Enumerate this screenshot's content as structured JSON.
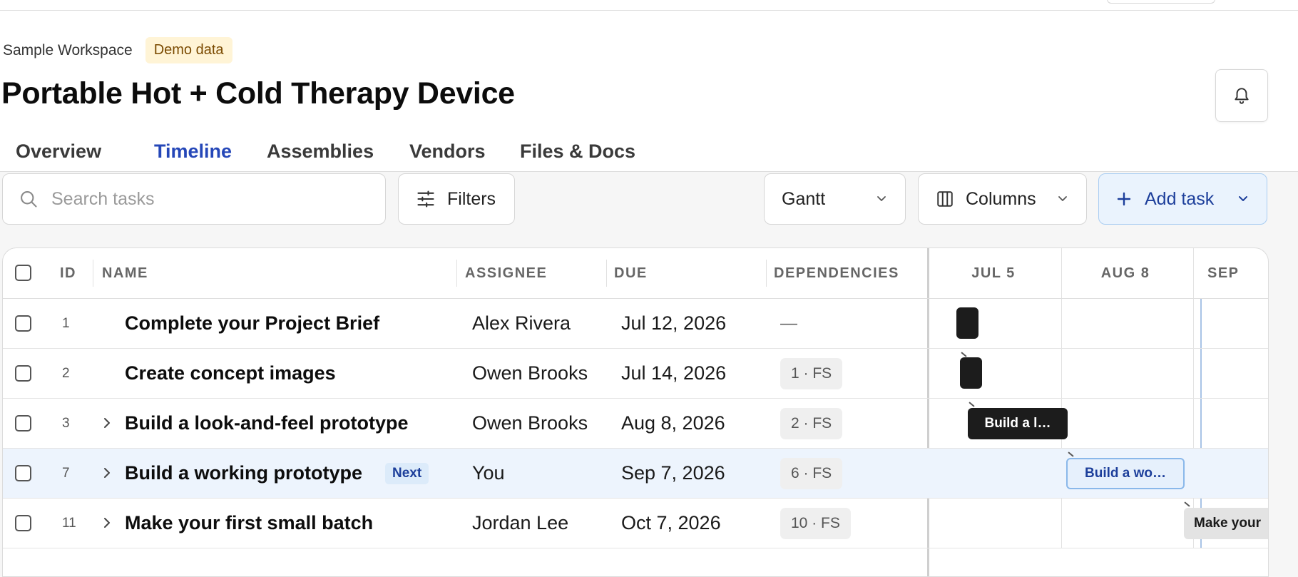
{
  "header": {
    "workspace": "Sample Workspace",
    "badge": "Demo data",
    "title": "Portable Hot + Cold Therapy Device"
  },
  "tabs": [
    {
      "label": "Overview"
    },
    {
      "label": "Timeline",
      "active": true
    },
    {
      "label": "Assemblies"
    },
    {
      "label": "Vendors"
    },
    {
      "label": "Files & Docs"
    }
  ],
  "toolbar": {
    "search_placeholder": "Search tasks",
    "filters_label": "Filters",
    "view_select": "Gantt",
    "columns_label": "Columns",
    "add_task_label": "Add task"
  },
  "table": {
    "headers": {
      "id": "ID",
      "name": "NAME",
      "assignee": "ASSIGNEE",
      "due": "DUE",
      "dependencies": "DEPENDENCIES"
    },
    "timeline_headers": [
      "JUL 5",
      "AUG 8",
      "SEP"
    ],
    "rows": [
      {
        "id": "1",
        "name": "Complete your Project Brief",
        "assignee": "Alex Rivera",
        "due": "Jul 12, 2026",
        "dependency": "—",
        "expandable": false
      },
      {
        "id": "2",
        "name": "Create concept images",
        "assignee": "Owen Brooks",
        "due": "Jul 14, 2026",
        "dependency": "1 · FS",
        "expandable": false
      },
      {
        "id": "3",
        "name": "Build a look-and-feel prototype",
        "assignee": "Owen Brooks",
        "due": "Aug 8, 2026",
        "dependency": "2 · FS",
        "expandable": true,
        "bar_label": "Build a l…"
      },
      {
        "id": "7",
        "name": "Build a working prototype",
        "assignee": "You",
        "due": "Sep 7, 2026",
        "dependency": "6 · FS",
        "expandable": true,
        "badge": "Next",
        "bar_label": "Build a wo…"
      },
      {
        "id": "11",
        "name": "Make your first small batch",
        "assignee": "Jordan Lee",
        "due": "Oct 7, 2026",
        "dependency": "10 · FS",
        "expandable": true,
        "bar_label": "Make your"
      }
    ]
  },
  "colors": {
    "accent": "#2547b8",
    "highlight_row": "#edf4fd",
    "demo_badge_bg": "#fff4d6",
    "bar_dark": "#1c1c1c"
  },
  "icons": {
    "notifications": "bell-icon",
    "search": "search-icon",
    "filters": "sliders-icon",
    "columns": "columns-icon",
    "add": "plus-icon",
    "dropdown": "chevron-down-icon",
    "expand": "chevron-right-icon"
  }
}
